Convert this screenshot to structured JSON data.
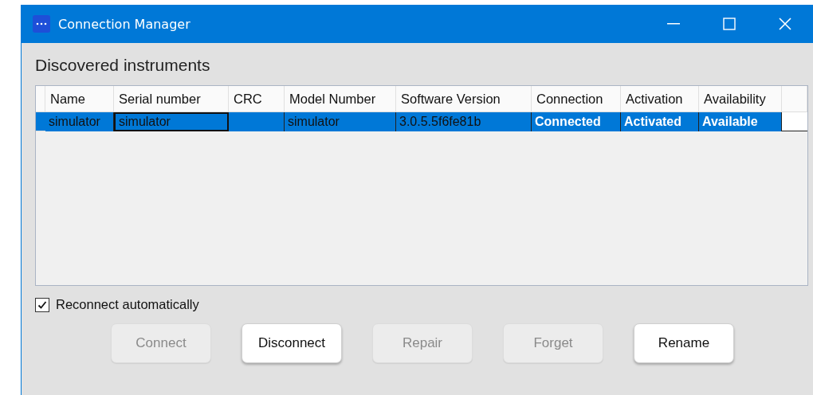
{
  "window": {
    "title": "Connection Manager"
  },
  "heading": "Discovered instruments",
  "table": {
    "columns": [
      "Name",
      "Serial number",
      "CRC",
      "Model Number",
      "Software Version",
      "Connection",
      "Activation",
      "Availability"
    ],
    "rows": [
      {
        "selected": true,
        "cells": [
          {
            "text": "simulator",
            "kind": "plain",
            "focused": false
          },
          {
            "text": "simulator",
            "kind": "plain",
            "focused": true
          },
          {
            "text": "",
            "kind": "plain",
            "focused": false
          },
          {
            "text": "simulator",
            "kind": "plain",
            "focused": false
          },
          {
            "text": "3.0.5.5f6fe81b",
            "kind": "plain",
            "focused": false
          },
          {
            "text": "Connected",
            "kind": "status",
            "focused": false
          },
          {
            "text": "Activated",
            "kind": "status",
            "focused": false
          },
          {
            "text": "Available",
            "kind": "status",
            "focused": false
          }
        ]
      }
    ]
  },
  "reconnect": {
    "label": "Reconnect automatically",
    "checked": true
  },
  "buttons": [
    {
      "label": "Connect",
      "disabled": true
    },
    {
      "label": "Disconnect",
      "disabled": false
    },
    {
      "label": "Repair",
      "disabled": true
    },
    {
      "label": "Forget",
      "disabled": true
    },
    {
      "label": "Rename",
      "disabled": false
    }
  ]
}
